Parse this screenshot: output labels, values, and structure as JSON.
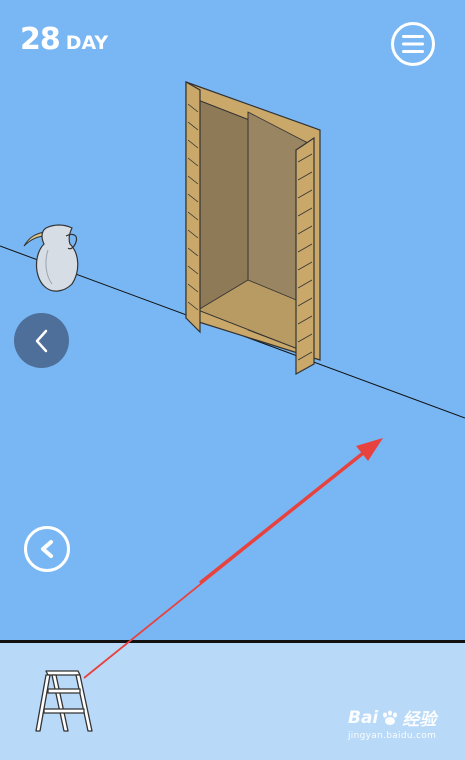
{
  "hud": {
    "day_number": "28",
    "day_label": "DAY",
    "menu_icon": "hamburger-menu-icon"
  },
  "scene": {
    "objects": [
      "vase",
      "wardrobe-open"
    ],
    "side_nav_icon": "chevron-left-icon"
  },
  "controls": {
    "back_icon": "chevron-left-icon"
  },
  "inventory": {
    "items": [
      {
        "name": "ladder",
        "icon": "step-ladder-icon"
      }
    ]
  },
  "overlay": {
    "arrow_color": "#e8423f"
  },
  "watermark": {
    "brand": "Bai",
    "brand_suffix": "经验",
    "url": "jingyan.baidu.com"
  },
  "colors": {
    "sky": "#79b7f4",
    "inventory_bg": "#b8d9f8",
    "wood": "#c9a86a",
    "wood_dark": "#8f7a58"
  }
}
